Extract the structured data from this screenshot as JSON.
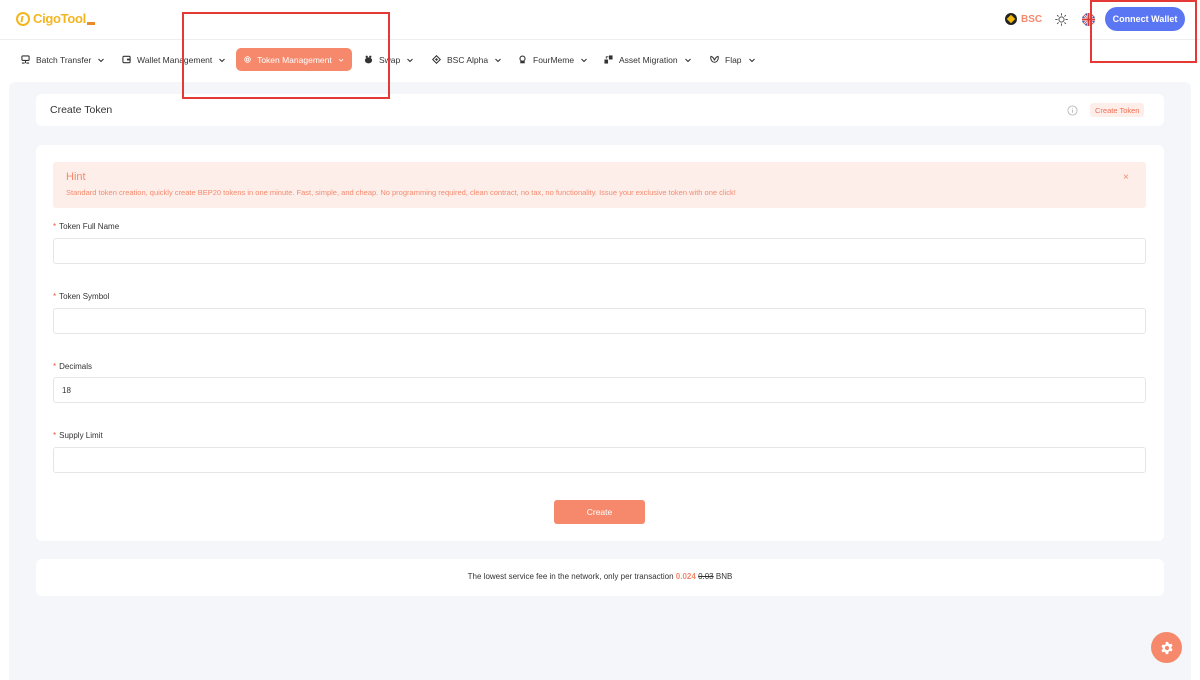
{
  "header": {
    "logo_text": "CigoTool",
    "network_label": "BSC",
    "connect_label": "Connect Wallet"
  },
  "nav": {
    "items": [
      {
        "label": "Batch Transfer",
        "icon": "batch-transfer-icon"
      },
      {
        "label": "Wallet Management",
        "icon": "wallet-icon"
      },
      {
        "label": "Token Management",
        "icon": "token-icon",
        "active": true
      },
      {
        "label": "Swap",
        "icon": "swap-icon"
      },
      {
        "label": "BSC Alpha",
        "icon": "bnb-icon"
      },
      {
        "label": "FourMeme",
        "icon": "fourmeme-icon"
      },
      {
        "label": "Asset Migration",
        "icon": "migration-icon"
      },
      {
        "label": "Flap",
        "icon": "flap-icon"
      }
    ]
  },
  "page": {
    "title": "Create Token",
    "chip_label": "Create Token"
  },
  "hint": {
    "title": "Hint",
    "text": "Standard token creation, quickly create BEP20 tokens in one minute. Fast, simple, and cheap. No programming required, clean contract, no tax, no functionality. Issue your exclusive token with one click!",
    "close": "×"
  },
  "form": {
    "required_mark": "*",
    "fields": [
      {
        "label": "Token Full Name",
        "value": ""
      },
      {
        "label": "Token Symbol",
        "value": ""
      },
      {
        "label": "Decimals",
        "value": "18"
      },
      {
        "label": "Supply Limit",
        "value": ""
      }
    ],
    "submit_label": "Create"
  },
  "fee": {
    "prefix": "The lowest service fee in the network, only per transaction",
    "price": "0.024",
    "old_price": "0.03",
    "currency": "BNB"
  },
  "colors": {
    "accent": "#f6896c",
    "connect": "#5b76f2",
    "brand": "#f5b51f"
  }
}
